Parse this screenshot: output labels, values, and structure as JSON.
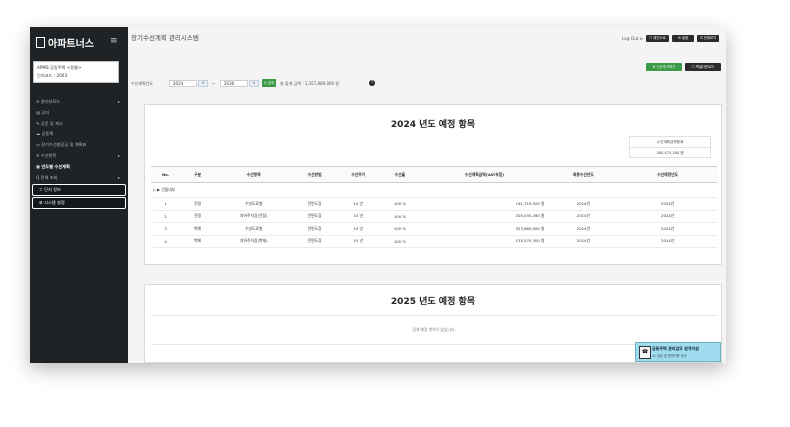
{
  "app": {
    "logo": "아파트너스",
    "menu_icon": "hamburger-icon",
    "complex_name": "APMS 공동주택 <원룸>",
    "complex_sub": "단지코드 : 2003"
  },
  "sidebar": {
    "items": [
      {
        "label": "관리자모드",
        "arrow": "▸"
      },
      {
        "label": "공지",
        "arrow": ""
      },
      {
        "label": "공문 및 게시",
        "arrow": ""
      },
      {
        "label": "공동체",
        "arrow": ""
      },
      {
        "label": "장기수선충당금 및 계획표",
        "arrow": ""
      },
      {
        "label": "수선항목",
        "arrow": "▸"
      },
      {
        "label": "년도별 수선계획",
        "arrow": ""
      },
      {
        "label": "전체 조회",
        "arrow": "▸"
      },
      {
        "label": "단지 정보",
        "arrow": ""
      },
      {
        "label": "시스템 설정",
        "arrow": ""
      }
    ]
  },
  "header": {
    "title": "장기수선계획 관리시스템",
    "logout": "Log Out ⊳",
    "buttons": [
      "☐ 메인으로",
      "⚙ 설정",
      "☰ 전체보기"
    ],
    "green_button": "⊕ 신규추가하기",
    "dark_button": "☐ 엑셀다운로드"
  },
  "filter": {
    "label": "수선계획년도",
    "from": "2024",
    "dropdown": "V",
    "sep": "~",
    "to": "2030",
    "search": "Q 검색",
    "total": "총 합계 금액 : 1,357,889,000 원"
  },
  "panel2024": {
    "title": "2024 년도 예정 항목",
    "sum_label": "수선계획금액합계",
    "sum_value": "380,475,280 원",
    "columns": [
      "No.",
      "구분",
      "수선항목",
      "수선방법",
      "수선주기",
      "수선율",
      "수선계획금액(VAT포함)",
      "최종수선년도",
      "수선예정년도"
    ],
    "group": "▷ ▶ 건물내부",
    "rows": [
      [
        "1",
        "전정",
        "수성도료칠",
        "전면도장",
        "10 년",
        "100 %",
        "191,719,000 원",
        "2014년",
        "2024년"
      ],
      [
        "2",
        "전정",
        "지하주차장(전정)",
        "전면도장",
        "10 년",
        "100 %",
        "205,035,280 원",
        "2014년",
        "2024년"
      ],
      [
        "3",
        "벽체",
        "수성도료칠",
        "전면도장",
        "10 년",
        "100 %",
        "323,685,000 원",
        "2014년",
        "2024년"
      ],
      [
        "4",
        "벽체",
        "지하주차장(벽체)",
        "전면도장",
        "10 년",
        "100 %",
        "135,570,300 원",
        "2014년",
        "2024년"
      ]
    ]
  },
  "panel2025": {
    "title": "2025 년도 예정 항목",
    "empty": "검색 예정 항목이 없습니다."
  },
  "banner": {
    "line1": "공동주택 관리업무 원격지원",
    "line2": "☏ 상담 및 원격지원 안내"
  },
  "colors": {
    "sidebar": "#1f2326",
    "accent_green": "#3a9a46",
    "banner": "#9fdcef"
  }
}
